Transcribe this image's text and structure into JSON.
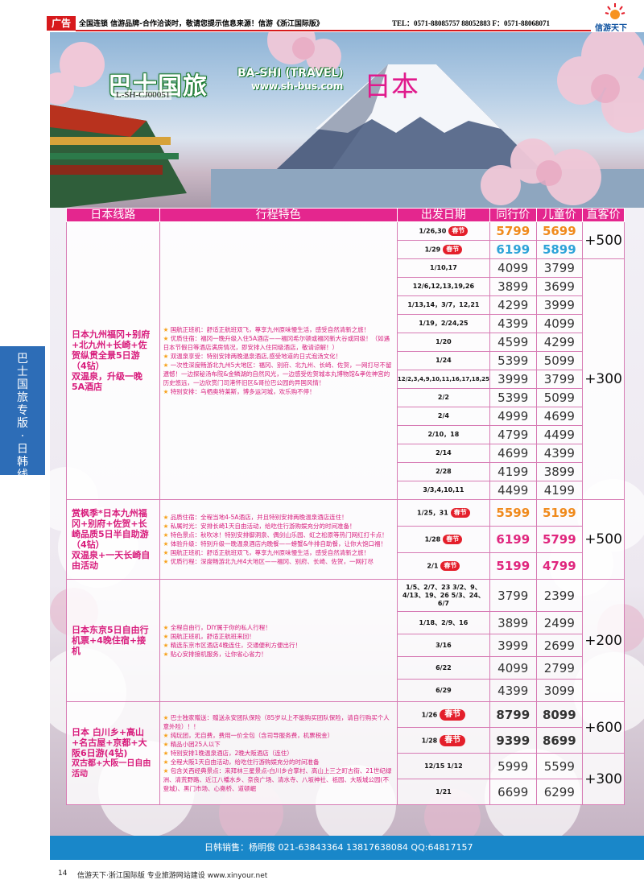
{
  "top": {
    "ad_label": "广告",
    "notice": "全国连锁 信游品牌-合作洽谈时，敬请您提示信息来源！信游《浙江国际版》",
    "tel": "TEL：0571-88085757 88052883  F：0571-88068071",
    "corner_logo_text": "信游天下"
  },
  "hero": {
    "brand": "巴士国旅",
    "brand_en": "BA-SHI (TRAVEL)",
    "url": "www.sh-bus.com",
    "code": "L-SH-CJ00051",
    "destination": "日本"
  },
  "side_tab": [
    "巴",
    "士",
    "国",
    "旅",
    "专",
    "版",
    "·",
    "日",
    "韩",
    "线"
  ],
  "table": {
    "headers": [
      "日本线路",
      "行程特色",
      "出发日期",
      "同行价",
      "儿童价",
      "直客价"
    ]
  },
  "routes": [
    {
      "name_lines": [
        "日本九州福冈+别府+北九州+长崎+佐贺纵贯全景5日游（4钻）",
        "双温泉，升级一晚5A酒店"
      ],
      "features": [
        "国航正班机：舒适正航班双飞，尊享九州原味慢生活，感受自然清新之旅！",
        "优质住宿：福冈一晚升级入住5A酒店——福冈希尔顿或福冈新大谷或同级！（如遇日本节假日等酒店满房情况，即安排入住同级酒店，敬请谅解！）",
        "双温泉享受：特别安排两晚温泉酒店,感受地道的日式泡汤文化！",
        "一次性深度畅游北九州5大地区：福冈、别府、北九州、长崎、佐贺，一网打尽不留遗憾！一边探秘汤布院&金鳞湖的自然风光，一边感受佐贺城本丸博物馆&孝佐神宫的历史悠远，一边欣赏门司港怀旧区&哥拉巴公园的异国风情！",
        "特别安排：乌栖奥特莱斯，博多运河城，欢乐购不停！"
      ],
      "departures": [
        {
          "date": "1/26,30",
          "badge": "春节",
          "peer": "5799",
          "child": "5699",
          "style": "festival"
        },
        {
          "date": "1/29",
          "badge": "春节",
          "peer": "6199",
          "child": "5899",
          "style": "festival"
        },
        {
          "date": "1/10,17",
          "badge": "",
          "peer": "4099",
          "child": "3799",
          "style": "normal"
        },
        {
          "date": "12/6,12,13,19,26",
          "badge": "",
          "peer": "3899",
          "child": "3699",
          "style": "normal"
        },
        {
          "date": "1/13,14，3/7，12,21",
          "badge": "",
          "peer": "4299",
          "child": "3999",
          "style": "normal"
        },
        {
          "date": "1/19，2/24,25",
          "badge": "",
          "peer": "4399",
          "child": "4099",
          "style": "normal"
        },
        {
          "date": "1/20",
          "badge": "",
          "peer": "4599",
          "child": "4299",
          "style": "normal"
        },
        {
          "date": "1/24",
          "badge": "",
          "peer": "5399",
          "child": "5099",
          "style": "normal"
        },
        {
          "date": "12/2,3,4,9,10,11,16,17,18,25",
          "badge": "",
          "peer": "3999",
          "child": "3799",
          "style": "normal"
        },
        {
          "date": "2/2",
          "badge": "",
          "peer": "5399",
          "child": "5099",
          "style": "normal"
        },
        {
          "date": "2/4",
          "badge": "",
          "peer": "4999",
          "child": "4699",
          "style": "normal"
        },
        {
          "date": "2/10，18",
          "badge": "",
          "peer": "4799",
          "child": "4499",
          "style": "normal"
        },
        {
          "date": "2/14",
          "badge": "",
          "peer": "4699",
          "child": "4399",
          "style": "normal"
        },
        {
          "date": "2/28",
          "badge": "",
          "peer": "4199",
          "child": "3899",
          "style": "normal"
        },
        {
          "date": "3/3,4,10,11",
          "badge": "",
          "peer": "4499",
          "child": "4199",
          "style": "normal"
        }
      ],
      "retail": [
        "+500",
        "+300"
      ]
    },
    {
      "name_lines": [
        "赏枫季*日本九州福冈+别府+佐贺+长崎品质5日半自助游（4钻）",
        "双温泉+一天长崎自由活动"
      ],
      "features": [
        "品质住宿：全程当地4-5A酒店，并且特别安排两晚温泉酒店连住！",
        "私属时光：安排长崎1天自由活动，给吃住行游购娱充分的时间准备！",
        "特色景点：秋吹冰！特别安排御洞泉、偶剑山乐园、虹之松原等热门网红打卡点！",
        "体验升级：特别升级一晚温泉酒店内晚餐——螃蟹&牛排自助餐，让你大饱口福！",
        "国航正班机：舒适正航班双飞，尊享九州原味慢生活，感受自然清新之旅！",
        "优质行程：深度畅游北九州4大地区——福冈、别府、长崎、佐贺，一网打尽"
      ],
      "departures": [
        {
          "date": "1/25，31",
          "badge": "春节",
          "peer": "5599",
          "child": "5199",
          "style": "festival"
        },
        {
          "date": "1/28",
          "badge": "春节",
          "peer": "6199",
          "child": "5799",
          "style": "festival-pink"
        },
        {
          "date": "2/1",
          "badge": "春节",
          "peer": "5199",
          "child": "4799",
          "style": "festival-pink"
        }
      ],
      "retail": [
        "+500"
      ]
    },
    {
      "name_lines": [
        "日本东京5日自由行机票+4晚住宿+接机"
      ],
      "features": [
        "全程自由行，DIY属于你的私人行程！",
        "国航正班机，舒适正航班来回！",
        "精选东京市区酒店4晚连住，交通便利方便出行！",
        "贴心安排接机服务，让你省心省力！"
      ],
      "departures": [
        {
          "date": "1/5、2/7、23  3/2、9、4/13、19、26  5/3、24、6/7",
          "badge": "",
          "peer": "3799",
          "child": "2399",
          "style": "normal"
        },
        {
          "date": "1/18、2/9、16",
          "badge": "",
          "peer": "3899",
          "child": "2499",
          "style": "normal"
        },
        {
          "date": "3/16",
          "badge": "",
          "peer": "3999",
          "child": "2699",
          "style": "normal"
        },
        {
          "date": "6/22",
          "badge": "",
          "peer": "4099",
          "child": "2799",
          "style": "normal"
        },
        {
          "date": "6/29",
          "badge": "",
          "peer": "4399",
          "child": "3099",
          "style": "normal"
        }
      ],
      "retail": [
        "+200"
      ]
    },
    {
      "name_lines": [
        "日本 白川乡+高山+名古屋+京都+大阪6日游(4钻)",
        "双古都+大阪一日自由活动"
      ],
      "features": [
        "巴士独家赠送：赠送永安团队保险（85岁以上不能购买团队保险，请自行购买个人意外险）！！",
        "纯玩团，无自费，费用一价全包（含司导服务费，机票税金）",
        "精品小团25人以下",
        "特别安排1晚温泉酒店，2晚大阪酒店（连住）",
        "全程大阪1天自由活动，给吃住行游购娱充分的时间准备",
        "包含关西经典景点：来拜林三星景点-白川乡合掌村、高山上三之町古街、21世纪绿洲、清荒野路、近江八幡水乡、奈良广场、清水寺、八坂神社、祇园、大阪城公园(不登城)、黑门市场、心斋桥、道顿崛"
      ],
      "departures": [
        {
          "date": "1/26",
          "badge": "春节",
          "peer": "8799",
          "child": "8099",
          "style": "festival-big"
        },
        {
          "date": "1/28",
          "badge": "春节",
          "peer": "9399",
          "child": "8699",
          "style": "festival-big"
        },
        {
          "date": "12/15  1/12",
          "badge": "",
          "peer": "5999",
          "child": "5599",
          "style": "normal"
        },
        {
          "date": "1/21",
          "badge": "",
          "peer": "6699",
          "child": "6299",
          "style": "normal"
        }
      ],
      "retail": [
        "+600",
        "+300"
      ]
    }
  ],
  "sales_bar": "日韩销售：杨明俊  021-63843364  13817638084  QQ:64817157",
  "footer": {
    "page": "14",
    "text": "信游天下·浙江国际版 专业旅游网站建设 www.xinyour.net"
  },
  "colors": {
    "header_pink": "#e4268e",
    "route_pink": "#d81c7c",
    "festival_badge": "#e41f2b",
    "sales_blue": "#1987c9",
    "price_orange": "#f08a1c",
    "price_blue": "#2da3d8"
  }
}
